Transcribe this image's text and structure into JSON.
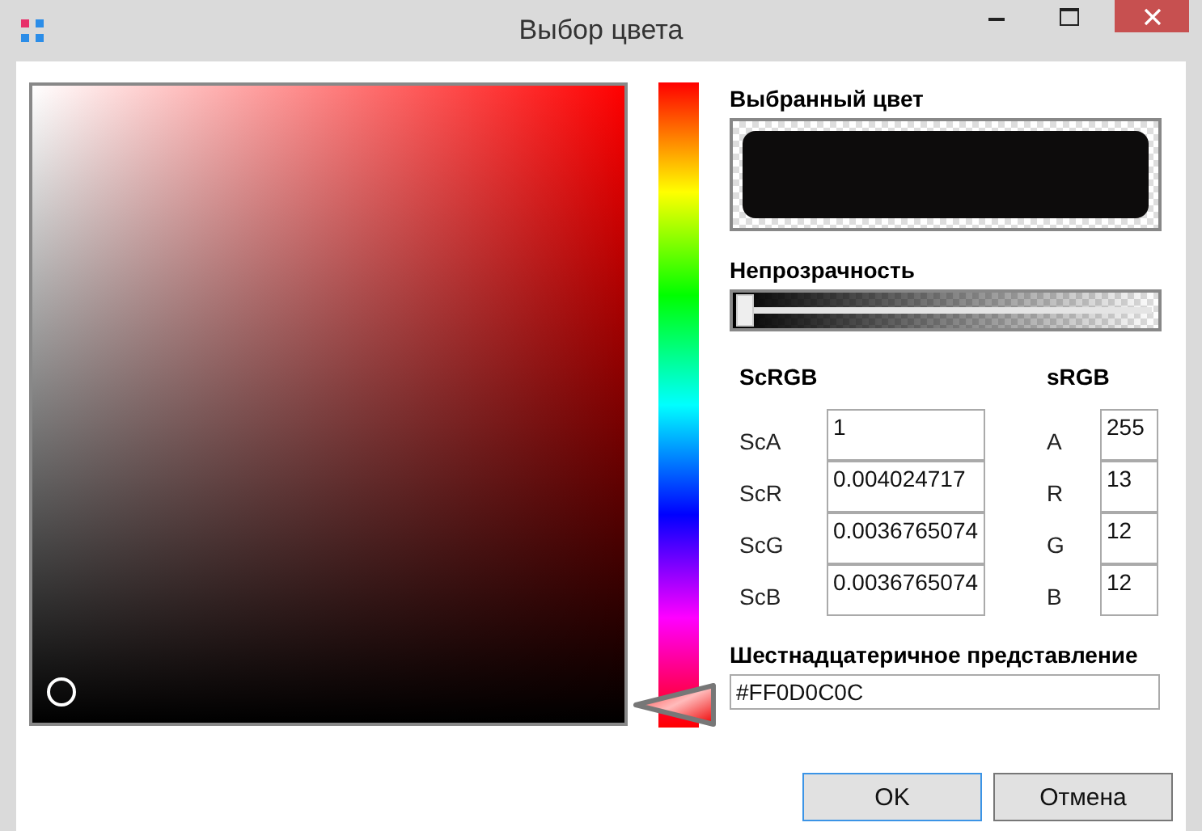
{
  "window": {
    "title": "Выбор цвета"
  },
  "selected_color": {
    "label": "Выбранный цвет",
    "color": "#0d0c0c"
  },
  "opacity": {
    "label": "Непрозрачность",
    "level": 0
  },
  "scrgb": {
    "title": "ScRGB",
    "fields": [
      {
        "label": "ScA",
        "value": "1"
      },
      {
        "label": "ScR",
        "value": "0.004024717"
      },
      {
        "label": "ScG",
        "value": "0.0036765074"
      },
      {
        "label": "ScB",
        "value": "0.0036765074"
      }
    ]
  },
  "srgb": {
    "title": "sRGB",
    "fields": [
      {
        "label": "A",
        "value": "255"
      },
      {
        "label": "R",
        "value": "13"
      },
      {
        "label": "G",
        "value": "12"
      },
      {
        "label": "B",
        "value": "12"
      }
    ]
  },
  "hex": {
    "label": "Шестнадцатеричное представление",
    "value": "#FF0D0C0C"
  },
  "buttons": [
    {
      "label": "OK",
      "selected": true
    },
    {
      "label": "Отмена",
      "selected": false
    }
  ]
}
